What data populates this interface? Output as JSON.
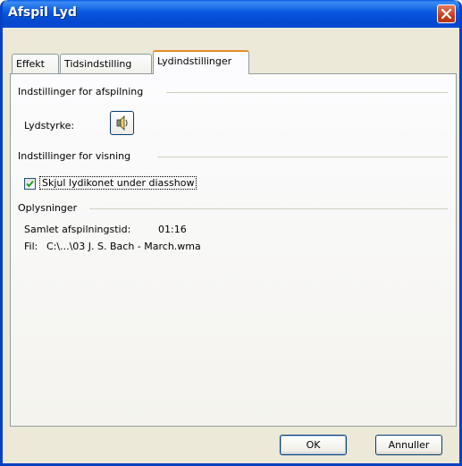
{
  "window": {
    "title": "Afspil Lyd"
  },
  "tabs": [
    {
      "label": "Effekt",
      "active": false
    },
    {
      "label": "Tidsindstilling",
      "active": false
    },
    {
      "label": "Lydindstillinger",
      "active": true
    }
  ],
  "playback": {
    "group_label": "Indstillinger for afspilning",
    "volume_label": "Lydstyrke:"
  },
  "display": {
    "group_label": "Indstillinger for visning",
    "hide_icon_label": "Skjul lydikonet under diasshow",
    "hide_icon_checked": true
  },
  "info": {
    "group_label": "Oplysninger",
    "total_time_label": "Samlet afspilningstid:",
    "total_time_value": "01:16",
    "file_label": "Fil:",
    "file_value": "C:\\...\\03 J. S. Bach - March.wma"
  },
  "buttons": {
    "ok": "OK",
    "cancel": "Annuller"
  },
  "colors": {
    "titlebar": "#0a4bd3",
    "active_tab_accent": "#e68b2c",
    "dialog_bg": "#ece9d8"
  }
}
